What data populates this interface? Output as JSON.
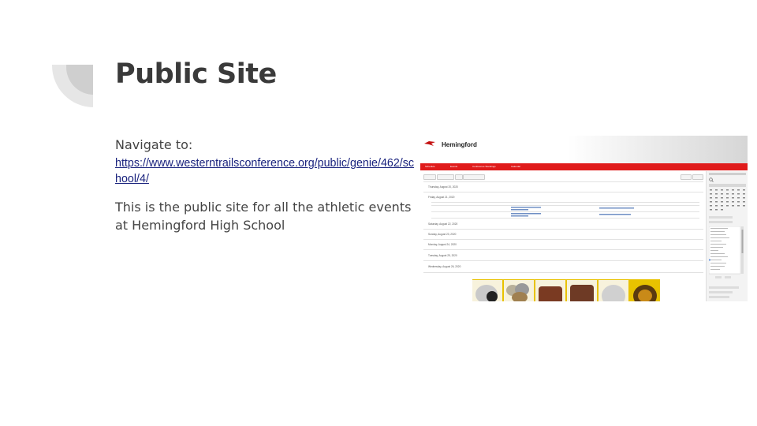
{
  "slide": {
    "title": "Public Site",
    "navigate_label": "Navigate to:",
    "link_text": "https://www.westerntrailsconference.org/public/genie/462/school/4/",
    "description": "This is the public site for all the athletic events at Hemingford High School"
  },
  "screenshot": {
    "site_name": "Hemingford",
    "brand_color": "#e01b1b",
    "nav_items": [
      "Schedule",
      "Events",
      "Conference Standings",
      "Calendar"
    ],
    "day_headers": [
      "Thursday, August 20, 2020",
      "Friday, August 21, 2020",
      "Saturday, August 22, 2020",
      "Sunday, August 23, 2020",
      "Monday, August 24, 2020",
      "Tuesday, August 25, 2020",
      "Wednesday, August 26, 2020"
    ]
  }
}
